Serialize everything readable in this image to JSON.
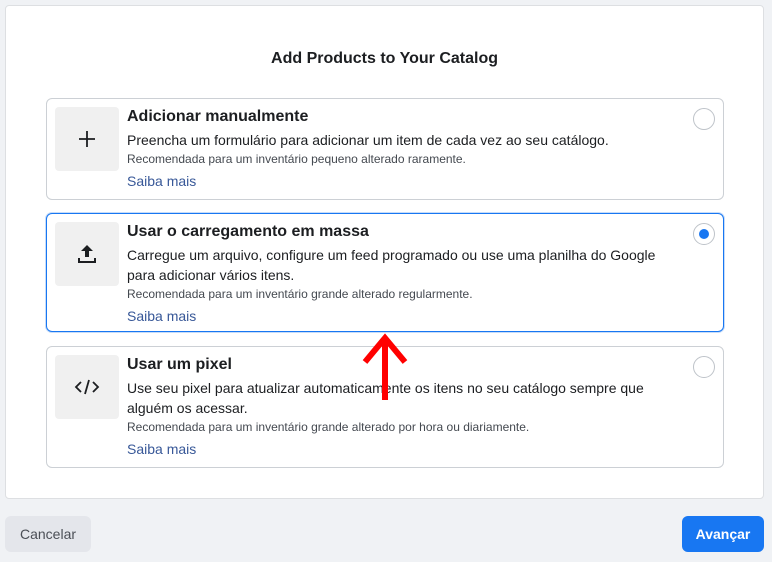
{
  "dialog": {
    "title": "Add Products to Your Catalog"
  },
  "options": [
    {
      "title": "Adicionar manualmente",
      "description": "Preencha um formulário para adicionar um item de cada vez ao seu catálogo.",
      "recommendation": "Recomendada para um inventário pequeno alterado raramente.",
      "link": "Saiba mais",
      "icon": "plus-icon",
      "selected": false
    },
    {
      "title": "Usar o carregamento em massa",
      "description": "Carregue um arquivo, configure um feed programado ou use uma planilha do Google para adicionar vários itens.",
      "recommendation": "Recomendada para um inventário grande alterado regularmente.",
      "link": "Saiba mais",
      "icon": "upload-icon",
      "selected": true
    },
    {
      "title": "Usar um pixel",
      "description": "Use seu pixel para atualizar automaticamente os itens no seu catálogo sempre que alguém os acessar.",
      "recommendation": "Recomendada para um inventário grande alterado por hora ou diariamente.",
      "link": "Saiba mais",
      "icon": "code-icon",
      "selected": false
    }
  ],
  "footer": {
    "cancel_label": "Cancelar",
    "next_label": "Avançar"
  },
  "colors": {
    "accent": "#1877f2",
    "link": "#385898",
    "annotation_arrow": "#ff0000"
  }
}
